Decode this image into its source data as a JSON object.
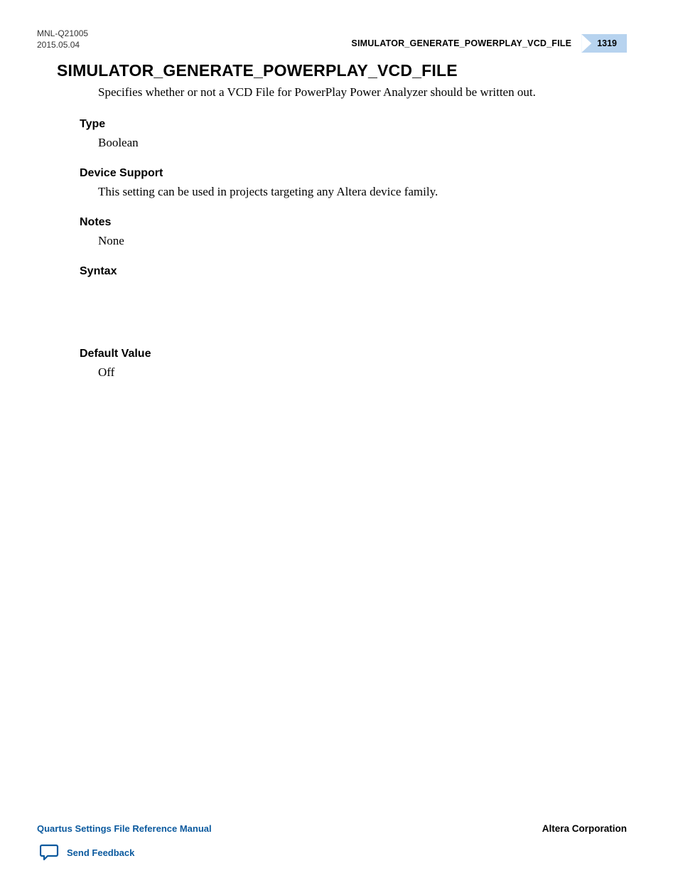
{
  "header": {
    "doc_id": "MNL-Q21005",
    "date": "2015.05.04",
    "running_title": "SIMULATOR_GENERATE_POWERPLAY_VCD_FILE",
    "page_number": "1319"
  },
  "title": "SIMULATOR_GENERATE_POWERPLAY_VCD_FILE",
  "intro": "Specifies whether or not a VCD File for PowerPlay Power Analyzer should be written out.",
  "sections": {
    "type": {
      "heading": "Type",
      "body": "Boolean"
    },
    "device_support": {
      "heading": "Device Support",
      "body": "This setting can be used in projects targeting any Altera device family."
    },
    "notes": {
      "heading": "Notes",
      "body": "None"
    },
    "syntax": {
      "heading": "Syntax",
      "body": ""
    },
    "default_value": {
      "heading": "Default Value",
      "body": "Off"
    }
  },
  "footer": {
    "manual_title": "Quartus Settings File Reference Manual",
    "company": "Altera Corporation",
    "feedback_label": "Send Feedback"
  },
  "colors": {
    "accent_blue": "#0a599e",
    "badge_bg": "#b7d3ef"
  }
}
